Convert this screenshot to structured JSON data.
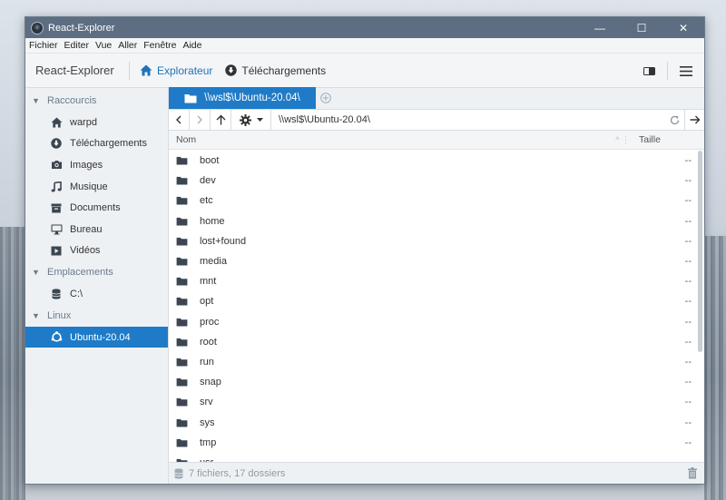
{
  "window": {
    "title": "React-Explorer",
    "controls": {
      "minimize": "—",
      "maximize": "☐",
      "close": "✕"
    }
  },
  "menu": [
    "Fichier",
    "Editer",
    "Vue",
    "Aller",
    "Fenêtre",
    "Aide"
  ],
  "toolbar": {
    "app_name": "React-Explorer",
    "links": [
      {
        "label": "Explorateur",
        "icon": "home-icon",
        "active": true
      },
      {
        "label": "Téléchargements",
        "icon": "download-icon",
        "active": false
      }
    ],
    "right_icons": [
      "panel-toggle-icon",
      "hamburger-menu-icon"
    ]
  },
  "sidebar": {
    "sections": [
      {
        "label": "Raccourcis",
        "items": [
          {
            "label": "warpd",
            "icon": "home-icon"
          },
          {
            "label": "Téléchargements",
            "icon": "download-icon"
          },
          {
            "label": "Images",
            "icon": "camera-icon"
          },
          {
            "label": "Musique",
            "icon": "music-icon"
          },
          {
            "label": "Documents",
            "icon": "archive-icon"
          },
          {
            "label": "Bureau",
            "icon": "monitor-icon"
          },
          {
            "label": "Vidéos",
            "icon": "video-icon"
          }
        ]
      },
      {
        "label": "Emplacements",
        "items": [
          {
            "label": "C:\\",
            "icon": "database-icon"
          }
        ]
      },
      {
        "label": "Linux",
        "items": [
          {
            "label": "Ubuntu-20.04",
            "icon": "ubuntu-icon",
            "selected": true
          }
        ]
      }
    ]
  },
  "tabs": [
    {
      "label": "\\\\wsl$\\Ubuntu-20.04\\",
      "icon": "folder-icon",
      "active": true
    }
  ],
  "navbar": {
    "path": "\\\\wsl$\\Ubuntu-20.04\\"
  },
  "columns": {
    "name": "Nom",
    "size": "Taille"
  },
  "files": [
    {
      "name": "boot",
      "size": "--"
    },
    {
      "name": "dev",
      "size": "--"
    },
    {
      "name": "etc",
      "size": "--"
    },
    {
      "name": "home",
      "size": "--"
    },
    {
      "name": "lost+found",
      "size": "--"
    },
    {
      "name": "media",
      "size": "--"
    },
    {
      "name": "mnt",
      "size": "--"
    },
    {
      "name": "opt",
      "size": "--"
    },
    {
      "name": "proc",
      "size": "--"
    },
    {
      "name": "root",
      "size": "--"
    },
    {
      "name": "run",
      "size": "--"
    },
    {
      "name": "snap",
      "size": "--"
    },
    {
      "name": "srv",
      "size": "--"
    },
    {
      "name": "sys",
      "size": "--"
    },
    {
      "name": "tmp",
      "size": "--"
    },
    {
      "name": "usr",
      "size": "--"
    }
  ],
  "status": {
    "text": "7 fichiers, 17 dossiers"
  },
  "colors": {
    "accent": "#1f7bc7",
    "titlebar": "#5d6e83",
    "sidebar": "#eef1f4"
  }
}
